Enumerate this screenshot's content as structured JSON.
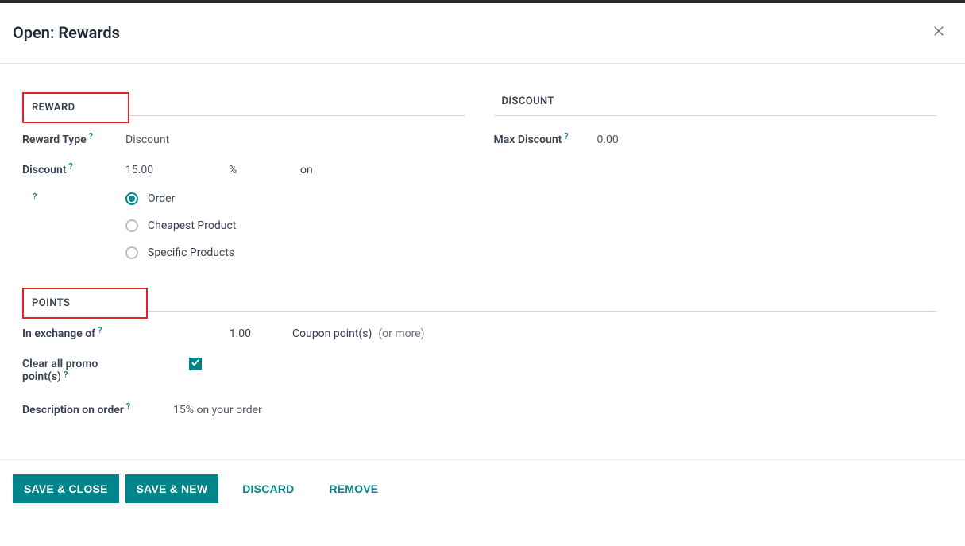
{
  "dialog": {
    "title": "Open: Rewards"
  },
  "reward": {
    "section_label": "REWARD",
    "type_label": "Reward Type",
    "type_value": "Discount",
    "discount_label": "Discount",
    "discount_value": "15.00",
    "discount_unit": "%",
    "discount_on": "on",
    "apply_options": {
      "order": "Order",
      "cheapest": "Cheapest Product",
      "specific": "Specific Products"
    },
    "apply_selected": "order"
  },
  "discount": {
    "section_label": "DISCOUNT",
    "max_label": "Max Discount",
    "max_value": "0.00"
  },
  "points": {
    "section_label": "POINTS",
    "exchange_label": "In exchange of",
    "exchange_value": "1.00",
    "exchange_unit": "Coupon point(s)",
    "exchange_more": "(or more)",
    "clear_label_line1": "Clear all promo",
    "clear_label_line2": "point(s)",
    "clear_checked": true,
    "description_label": "Description on order",
    "description_value": "15% on your order"
  },
  "footer": {
    "save_close": "SAVE & CLOSE",
    "save_new": "SAVE & NEW",
    "discard": "DISCARD",
    "remove": "REMOVE"
  }
}
